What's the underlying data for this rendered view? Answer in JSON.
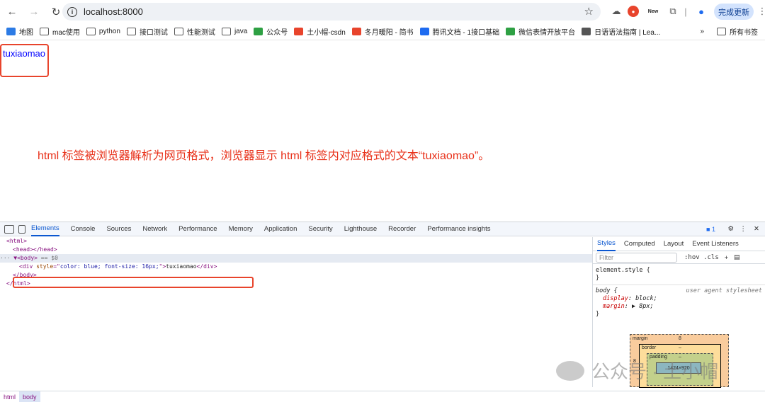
{
  "browser": {
    "url": "localhost:8000",
    "update_label": "完成更新",
    "new_badge": "New"
  },
  "bookmarks": [
    {
      "label": "地图",
      "color": "#2c7be5",
      "icon": "map-pin-icon"
    },
    {
      "label": "mac使用",
      "color": "",
      "icon": "folder-icon"
    },
    {
      "label": "python",
      "color": "",
      "icon": "folder-icon"
    },
    {
      "label": "接口测试",
      "color": "",
      "icon": "folder-icon"
    },
    {
      "label": "性能测试",
      "color": "",
      "icon": "folder-icon"
    },
    {
      "label": "java",
      "color": "",
      "icon": "folder-icon"
    },
    {
      "label": "公众号",
      "color": "#2ea043",
      "icon": "leaf-icon"
    },
    {
      "label": "土小帽-csdn",
      "color": "#e8442c",
      "icon": "csdn-icon"
    },
    {
      "label": "冬月暖阳 - 简书",
      "color": "#e8442c",
      "icon": "jianshu-icon"
    },
    {
      "label": "腾讯文档 - 1接口基础",
      "color": "#1e6bf0",
      "icon": "tencent-docs-icon"
    },
    {
      "label": "微信表情开放平台",
      "color": "#2ea043",
      "icon": "wechat-icon"
    },
    {
      "label": "日语语法指南 | Lea...",
      "color": "#555555",
      "icon": "italic-i-icon"
    }
  ],
  "bookmarks_more": "所有书签",
  "page": {
    "text": "tuxiaomao",
    "annotation": "html 标签被浏览器解析为网页格式，浏览器显示 html 标签内对应格式的文本“tuxiaomao”。"
  },
  "devtools": {
    "tabs": [
      "Elements",
      "Console",
      "Sources",
      "Network",
      "Performance",
      "Memory",
      "Application",
      "Security",
      "Lighthouse",
      "Recorder",
      "Performance insights"
    ],
    "issues_count": "1",
    "dom": {
      "l1": "<html>",
      "l2": "<head></head>",
      "l3a": "▼<body>",
      "l3b": " == $0",
      "l4_tag_open": "<div ",
      "l4_attr": "style",
      "l4_eq": "=\"",
      "l4_val": "color: blue; font-size: 16px;",
      "l4_close": "\">",
      "l4_text": "tuxiaomao",
      "l4_end": "</div>",
      "l5": "</body>",
      "l6": "</html>"
    },
    "side_tabs": [
      "Styles",
      "Computed",
      "Layout",
      "Event Listeners"
    ],
    "filter_placeholder": "Filter",
    "filter_tools": ":hov  .cls",
    "styles": {
      "element_style": "element.style {",
      "close1": "}",
      "body_sel": "body {",
      "ua": "user agent stylesheet",
      "p1_name": "display",
      "p1_val": ": block;",
      "p2_name": "margin",
      "p2_val": ": ▶ 8px;",
      "close2": "}"
    },
    "boxmodel": {
      "margin_label": "margin",
      "margin_val": "8",
      "border_label": "border",
      "border_val": "–",
      "padding_label": "padding",
      "padding_val": "–",
      "content": "1424×920",
      "side_val": "8"
    },
    "breadcrumb": [
      "html",
      "body"
    ]
  },
  "watermark": "公众号 · 土小帽"
}
